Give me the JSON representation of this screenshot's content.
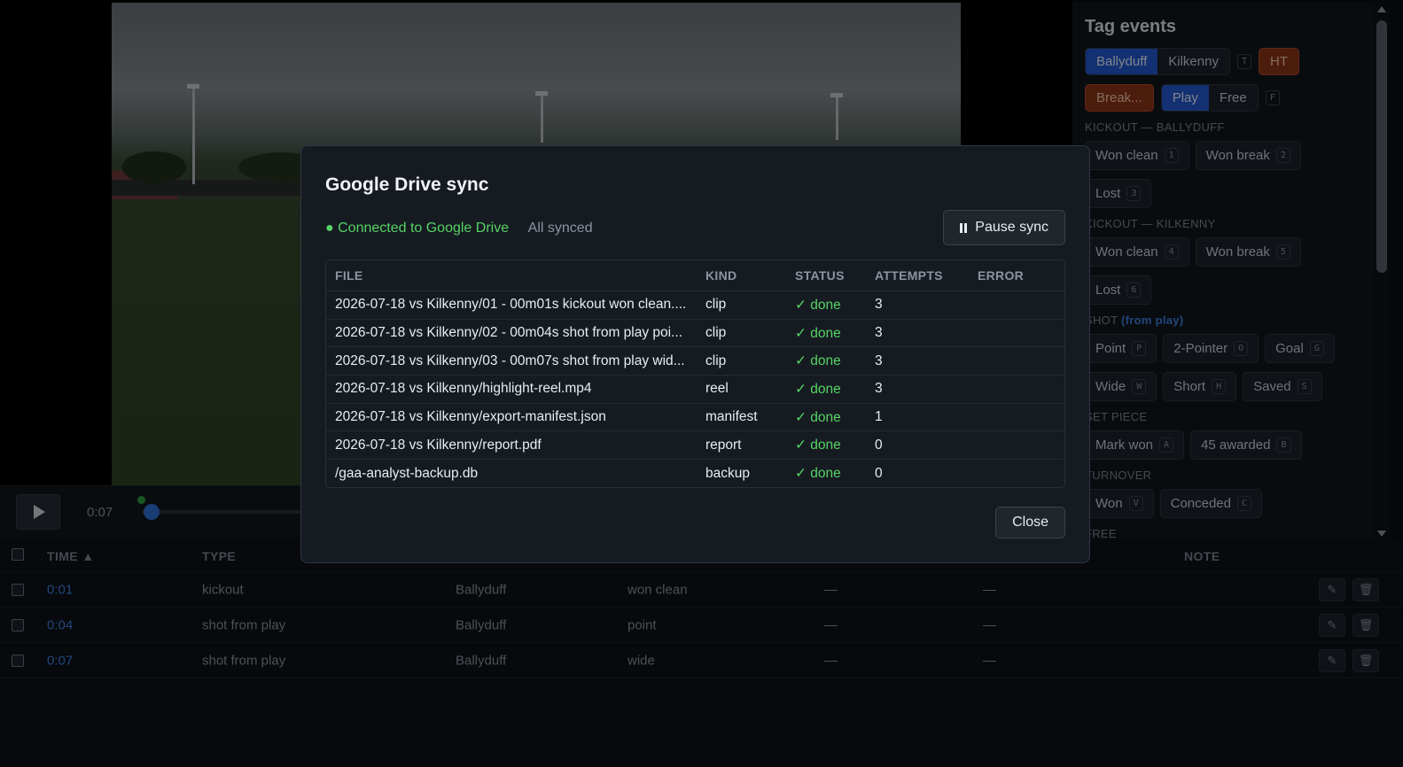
{
  "player": {
    "current_time": "0:07",
    "progress_fraction": 0.003
  },
  "sidebar": {
    "title": "Tag events",
    "team_toggle": [
      "Ballyduff",
      "Kilkenny"
    ],
    "team_key": "T",
    "ht_label": "HT",
    "break_label": "Break...",
    "mode_toggle": [
      "Play",
      "Free"
    ],
    "mode_key": "F",
    "sections": [
      {
        "title": "KICKOUT — BALLYDUFF",
        "accent": "",
        "rows": [
          [
            {
              "label": "Won clean",
              "key": "1"
            },
            {
              "label": "Won break",
              "key": "2"
            }
          ],
          [
            {
              "label": "Lost",
              "key": "3"
            }
          ]
        ]
      },
      {
        "title": "KICKOUT — KILKENNY",
        "accent": "",
        "rows": [
          [
            {
              "label": "Won clean",
              "key": "4"
            },
            {
              "label": "Won break",
              "key": "5"
            }
          ],
          [
            {
              "label": "Lost",
              "key": "6"
            }
          ]
        ]
      },
      {
        "title": "SHOT",
        "accent": "(from play)",
        "rows": [
          [
            {
              "label": "Point",
              "key": "P"
            },
            {
              "label": "2-Pointer",
              "key": "O"
            },
            {
              "label": "Goal",
              "key": "G"
            }
          ],
          [
            {
              "label": "Wide",
              "key": "W"
            },
            {
              "label": "Short",
              "key": "H"
            },
            {
              "label": "Saved",
              "key": "S"
            }
          ]
        ]
      },
      {
        "title": "SET PIECE",
        "accent": "",
        "rows": [
          [
            {
              "label": "Mark won",
              "key": "A"
            },
            {
              "label": "45 awarded",
              "key": "B"
            }
          ]
        ]
      },
      {
        "title": "TURNOVER",
        "accent": "",
        "rows": [
          [
            {
              "label": "Won",
              "key": "V"
            },
            {
              "label": "Conceded",
              "key": "C"
            }
          ]
        ]
      },
      {
        "title": "FREE",
        "accent": "",
        "rows": []
      }
    ]
  },
  "events_table": {
    "headers": {
      "time": "TIME ▲",
      "type": "TYPE",
      "note": "NOTE"
    },
    "rows": [
      {
        "time": "0:01",
        "type": "kickout",
        "team": "Ballyduff",
        "outcome": "won clean",
        "c5": "—",
        "c6": "—"
      },
      {
        "time": "0:04",
        "type": "shot from play",
        "team": "Ballyduff",
        "outcome": "point",
        "c5": "—",
        "c6": "—"
      },
      {
        "time": "0:07",
        "type": "shot from play",
        "team": "Ballyduff",
        "outcome": "wide",
        "c5": "—",
        "c6": "—"
      }
    ]
  },
  "modal": {
    "title": "Google Drive sync",
    "connected": "● Connected to Google Drive",
    "sync_state": "All synced",
    "pause_label": "Pause sync",
    "close_label": "Close",
    "headers": [
      "FILE",
      "KIND",
      "STATUS",
      "ATTEMPTS",
      "ERROR"
    ],
    "rows": [
      {
        "file": "2026-07-18 vs Kilkenny/01 - 00m01s kickout won clean....",
        "kind": "clip",
        "status": "✓ done",
        "attempts": "3",
        "error": ""
      },
      {
        "file": "2026-07-18 vs Kilkenny/02 - 00m04s shot from play poi...",
        "kind": "clip",
        "status": "✓ done",
        "attempts": "3",
        "error": ""
      },
      {
        "file": "2026-07-18 vs Kilkenny/03 - 00m07s shot from play wid...",
        "kind": "clip",
        "status": "✓ done",
        "attempts": "3",
        "error": ""
      },
      {
        "file": "2026-07-18 vs Kilkenny/highlight-reel.mp4",
        "kind": "reel",
        "status": "✓ done",
        "attempts": "3",
        "error": ""
      },
      {
        "file": "2026-07-18 vs Kilkenny/export-manifest.json",
        "kind": "manifest",
        "status": "✓ done",
        "attempts": "1",
        "error": ""
      },
      {
        "file": "2026-07-18 vs Kilkenny/report.pdf",
        "kind": "report",
        "status": "✓ done",
        "attempts": "0",
        "error": ""
      },
      {
        "file": "/gaa-analyst-backup.db",
        "kind": "backup",
        "status": "✓ done",
        "attempts": "0",
        "error": ""
      }
    ]
  },
  "colors": {
    "accent_blue": "#2458d0",
    "link_blue": "#3f7fe4",
    "success_green": "#56d364",
    "warn_orange": "#8a3617"
  }
}
